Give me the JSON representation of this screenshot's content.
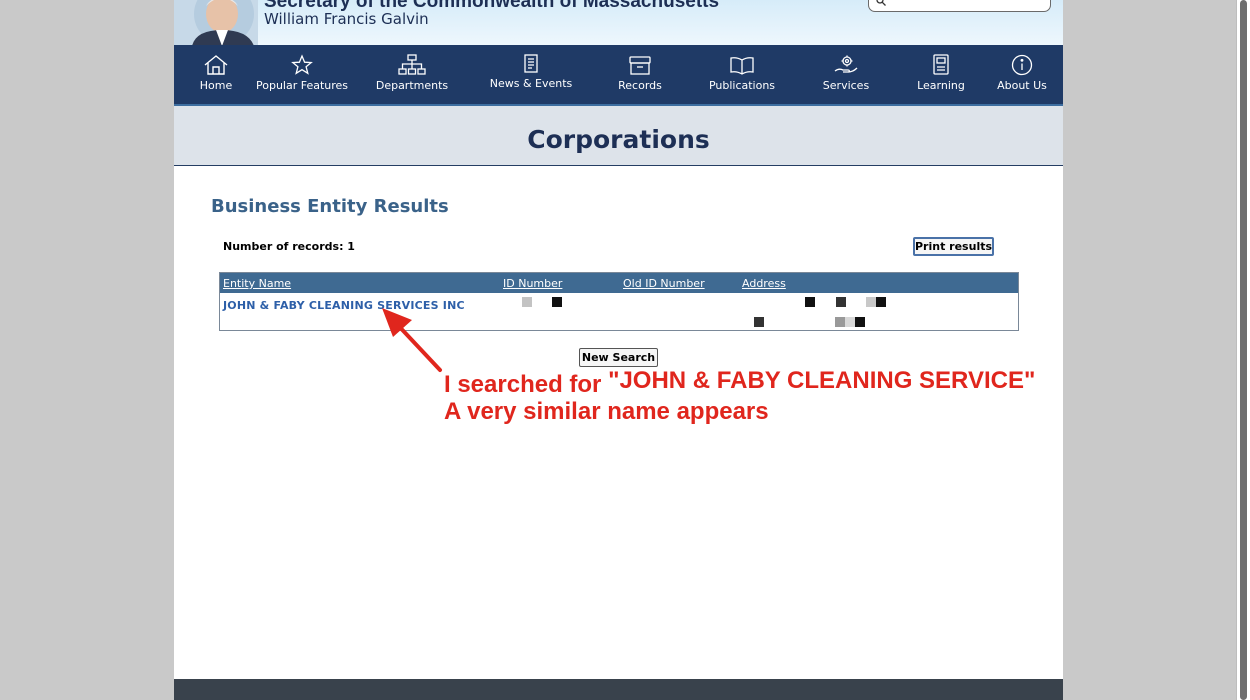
{
  "header": {
    "title": "Secretary of the Commonwealth of Massachusetts",
    "subtitle": "William Francis Galvin",
    "search_placeholder": ""
  },
  "nav": {
    "items": [
      {
        "label": "Home",
        "icon": "home-icon"
      },
      {
        "label": "Popular Features",
        "icon": "star-icon"
      },
      {
        "label": "Departments",
        "icon": "org-chart-icon"
      },
      {
        "label": "News & Events",
        "icon": "news-icon"
      },
      {
        "label": "Records",
        "icon": "archive-box-icon"
      },
      {
        "label": "Publications",
        "icon": "open-book-icon"
      },
      {
        "label": "Services",
        "icon": "hand-gear-icon"
      },
      {
        "label": "Learning",
        "icon": "book-icon"
      },
      {
        "label": "About Us",
        "icon": "info-icon"
      }
    ]
  },
  "banner": {
    "title": "Corporations"
  },
  "results": {
    "heading": "Business Entity Results",
    "records_label": "Number of records: 1",
    "print_button": "Print results",
    "new_search_button": "New Search",
    "columns": [
      "Entity Name",
      "ID Number",
      "Old ID Number",
      "Address"
    ],
    "rows": [
      {
        "entity_name": "JOHN & FABY CLEANING SERVICES INC"
      }
    ]
  },
  "annotation": {
    "line1_prefix": "I searched for ",
    "line1_quote": "\"JOHN & FABY CLEANING SERVICE\"",
    "line2": "A very similar name appears",
    "color": "#e0261d"
  },
  "colors": {
    "nav_bg": "#1f3a66",
    "table_header_bg": "#3f6a92",
    "link": "#2d5fa8",
    "heading": "#3a6289"
  }
}
